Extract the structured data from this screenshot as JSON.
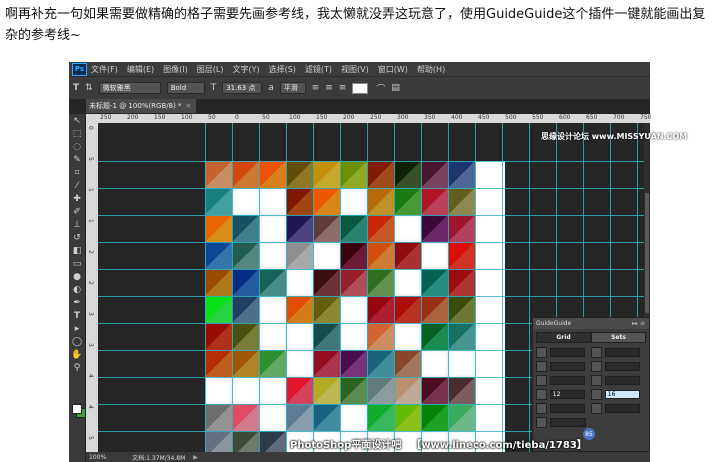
{
  "caption": {
    "text": "啊再补充一句如果需要做精确的格子需要先画参考线，我太懒就没弄这玩意了，使用GuideGuide这个插件一键就能画出复杂的参考线~"
  },
  "app": {
    "logo": "Ps",
    "menu": [
      "文件(F)",
      "编辑(E)",
      "图像(I)",
      "图层(L)",
      "文字(Y)",
      "选择(S)",
      "滤镜(T)",
      "视图(V)",
      "窗口(W)",
      "帮助(H)"
    ]
  },
  "options": {
    "font_family": "微软雅黑",
    "font_style": "Bold",
    "font_size": "31.63 点",
    "antialias": "平滑",
    "color": "#ffffff"
  },
  "document": {
    "tab_title": "未标题-1 @ 100%(RGB/8) *",
    "close_glyph": "×"
  },
  "rulers": {
    "h_labels": [
      "250",
      "200",
      "150",
      "100",
      "50",
      "0",
      "50",
      "100",
      "150",
      "200",
      "250",
      "300",
      "350",
      "400",
      "450",
      "500",
      "550",
      "600",
      "650",
      "700",
      "750"
    ],
    "v_labels": [
      "0",
      "5",
      "1",
      "1",
      "2",
      "2",
      "3",
      "3",
      "4",
      "4",
      "5"
    ]
  },
  "status": {
    "zoom": "100%",
    "doc_size": "文档:1.37M/34.8M",
    "arrow": "▶"
  },
  "guideguide": {
    "title": "GuideGuide",
    "controls": "▸▸ ≡",
    "tab_grid": "Grid",
    "tab_sets": "Sets",
    "columns_value": "12",
    "rows_value": "16"
  },
  "watermark": {
    "text": "PhotoShop平面设计吧",
    "url": "【www.lineco.com/tieba/1783】",
    "badge": "85"
  },
  "site_watermark": "思缘设计论坛  www.MISSYUAN.COM",
  "colors": {
    "guide": "#2fb3c4",
    "canvas_bg": "#262626",
    "panel_bg": "#3d3d3d"
  },
  "grid_colors": [
    [
      "#e0a070",
      "#e8873a",
      "#f6901e",
      "#9f8a2c",
      "#e0c030",
      "#a5c02a",
      "#b4541c",
      "#3f5c2d",
      "#8a4b6b",
      "#5875a8"
    ],
    [
      "#4cb5b5",
      "#ffffff",
      "#ffffff",
      "#b64d12",
      "#f6961c",
      "#ffffff",
      "#d8a52f",
      "#50b040",
      "#d44a63",
      "#9f9b5a"
    ],
    [
      "#f4a01d",
      "#4c8f9f",
      "#ffffff",
      "#5a4b8f",
      "#9f7a7a",
      "#32967f",
      "#e2622b",
      "#ffffff",
      "#7a2f7a",
      "#c94a6a"
    ],
    [
      "#3a86c3",
      "#5e9a8e",
      "#ffffff",
      "#bfbfbf",
      "#ffffff",
      "#7a1f3c",
      "#e88e3a",
      "#c03838",
      "#ffffff",
      "#ec3a2a"
    ],
    [
      "#c78a1f",
      "#2a69b6",
      "#4f9f97",
      "#ffffff",
      "#7a3b3b",
      "#c45a68",
      "#6fa85a",
      "#ffffff",
      "#2a9f8f",
      "#c83a3a"
    ],
    [
      "#2cf04a",
      "#5a7fa0",
      "#ffffff",
      "#f08d1c",
      "#9f9a3a",
      "#ffffff",
      "#c4223a",
      "#d23a2a",
      "#c46e4a",
      "#7a8a3a"
    ],
    [
      "#c43a1a",
      "#8a8f3f",
      "#ffffff",
      "#ffffff",
      "#4a8a8a",
      "#ffffff",
      "#e8a070",
      "#ffffff",
      "#1f9f5a",
      "#4fa8a0"
    ],
    [
      "#d86b22",
      "#c8952a",
      "#6fbf6f",
      "#ffffff",
      "#c43a5a",
      "#8a3a8a",
      "#4aa0b0",
      "#b8866a",
      "#ffffff",
      "#ffffff"
    ],
    [
      "#ffffff",
      "#ffffff",
      "#ffffff",
      "#f04a6a",
      "#d6d060",
      "#6a9f5a",
      "#9fb0b4",
      "#d9c0a8",
      "#8a3a5a",
      "#8a6a6a"
    ],
    [
      "#a7a7a7",
      "#f08aa0",
      "#ffffff",
      "#9ab2c5",
      "#4a9fb4",
      "#ffffff",
      "#3fd26a",
      "#9fdb1f",
      "#21b72a",
      "#7ad09a"
    ],
    [
      "#9fa9b4",
      "#7f8a7a",
      "#6a7a8a",
      "#ffffff",
      "#ffffff",
      "#ffffff",
      "#ffffff",
      "#ffffff",
      "#ffffff",
      "#ffffff"
    ]
  ]
}
